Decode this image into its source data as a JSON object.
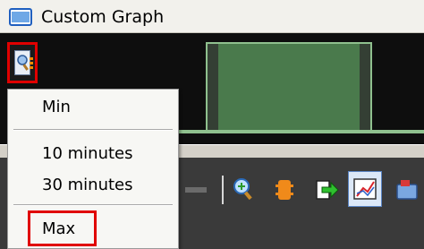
{
  "window": {
    "title": "Custom Graph",
    "icon": "window-app-icon"
  },
  "graph": {
    "range_button_icon": "magnifier-range-icon"
  },
  "menu": {
    "items": [
      "Min",
      "10 minutes",
      "30 minutes",
      "Max"
    ],
    "selected": "Max"
  },
  "toolbar": {
    "icons": [
      "scroll-back-icon",
      "zoom-in-icon",
      "orange-block-icon",
      "export-arrow-icon",
      "line-chart-icon",
      "folder-icon"
    ]
  },
  "colors": {
    "highlight": "#e00000",
    "graph_bg": "#0e0e0e",
    "graph_fill": "#4a7a4c"
  }
}
